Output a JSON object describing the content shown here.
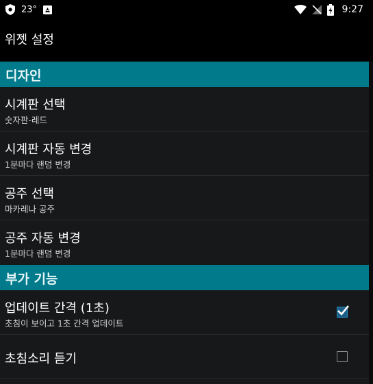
{
  "status_bar": {
    "temperature": "23°",
    "time": "9:27",
    "left_icons": [
      "shield-icon",
      "news-icon"
    ],
    "right_icons": [
      "wifi-icon",
      "no-signal-icon",
      "battery-charging-icon"
    ]
  },
  "action_bar": {
    "title": "위젯 설정"
  },
  "sections": [
    {
      "header": "디자인",
      "items": [
        {
          "title": "시계판 선택",
          "summary": "숫자판-레드"
        },
        {
          "title": "시계판 자동 변경",
          "summary": "1분마다 랜덤 변경"
        },
        {
          "title": "공주 선택",
          "summary": "마카레나 공주"
        },
        {
          "title": "공주 자동 변경",
          "summary": "1분마다 랜덤 변경"
        }
      ]
    },
    {
      "header": "부가 기능",
      "items": [
        {
          "title": "업데이트 간격 (1초)",
          "summary": "초침이 보이고 1초 간격 업데이트",
          "checked": true
        },
        {
          "title": "초침소리 듣기",
          "summary": "",
          "checked": false
        }
      ]
    }
  ],
  "colors": {
    "section_header_bg": "#017b8c",
    "list_bg": "#16181a",
    "checkbox_checked": "#2a8ec8"
  }
}
